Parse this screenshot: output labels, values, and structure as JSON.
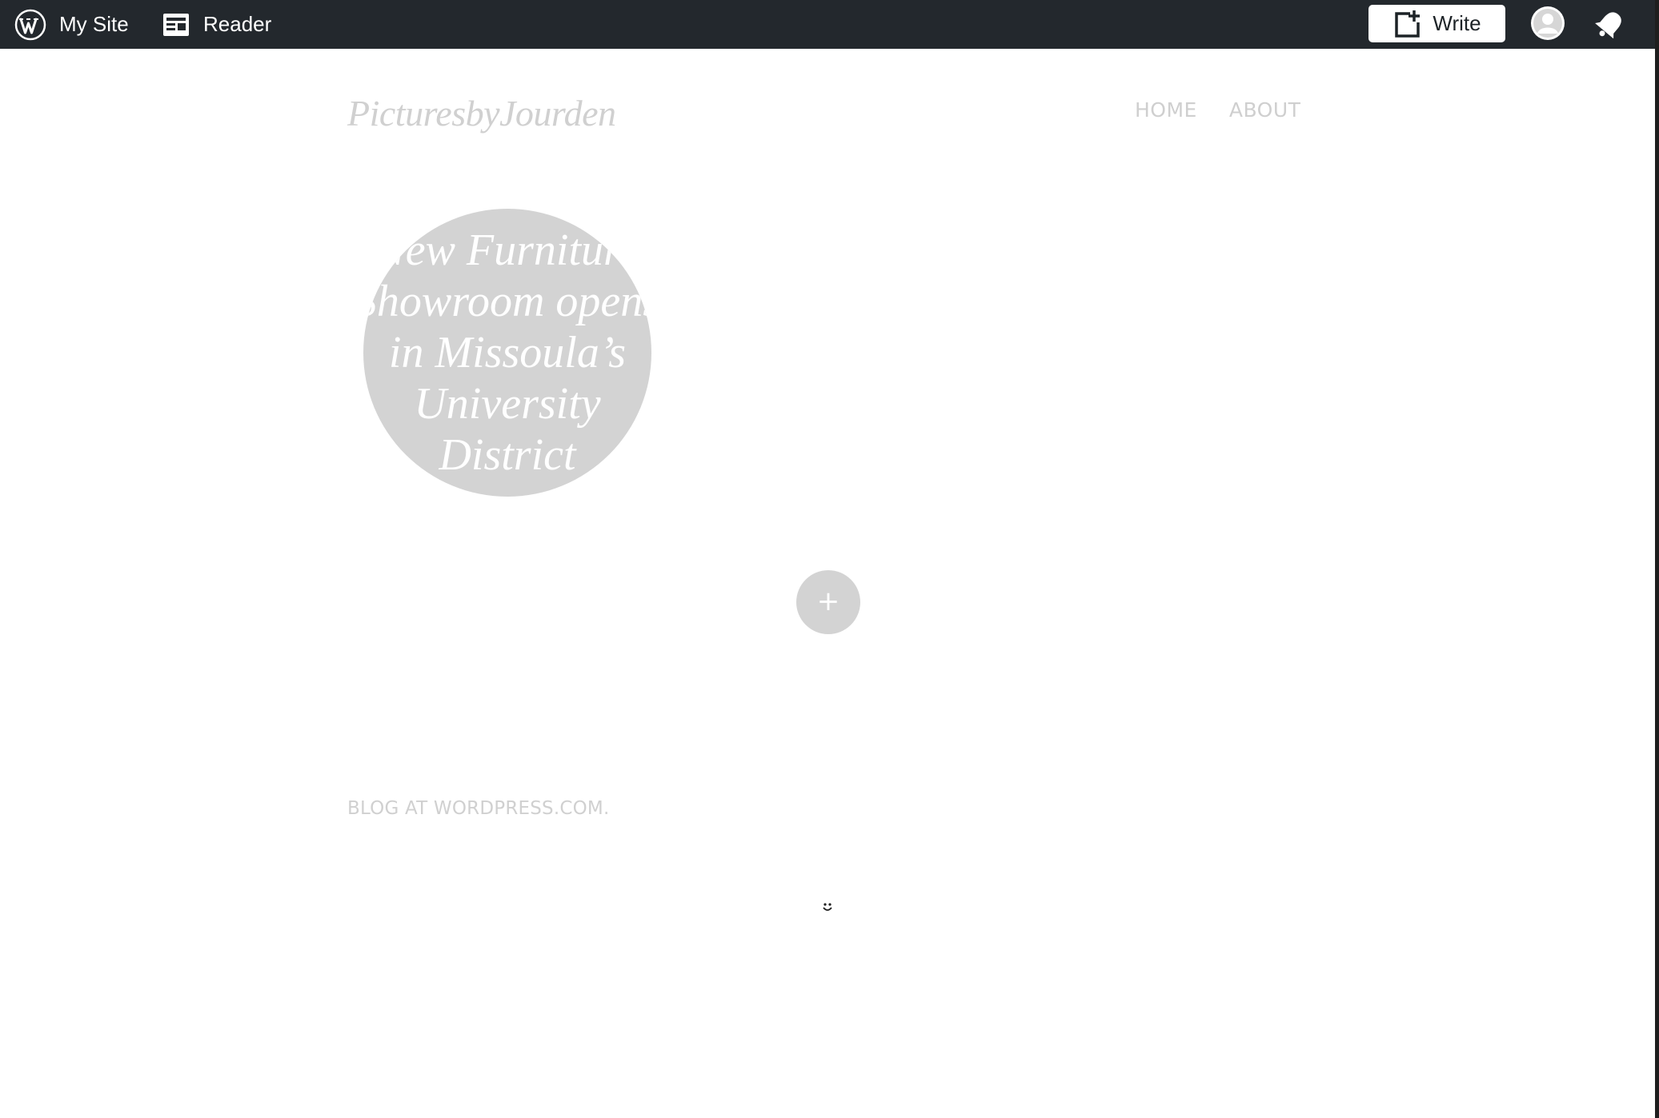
{
  "admin_bar": {
    "my_site_label": "My Site",
    "reader_label": "Reader",
    "write_label": "Write",
    "icons": {
      "logo": "wordpress-logo-icon",
      "reader": "reader-icon",
      "write": "new-post-icon",
      "avatar": "user-avatar-icon",
      "notifications": "notifications-bell-icon"
    },
    "background_color": "#23282d"
  },
  "site": {
    "title": "PicturesbyJourden",
    "nav": [
      {
        "label": "HOME"
      },
      {
        "label": "ABOUT"
      }
    ]
  },
  "posts": [
    {
      "title_lines": [
        "New Furniture",
        "Showroom opens",
        "in Missoula’s",
        "University",
        "District"
      ]
    }
  ],
  "load_more": {
    "glyph": "+",
    "icon": "plus-icon"
  },
  "footer": {
    "credit": "BLOG AT WORDPRESS.COM."
  },
  "colors": {
    "accent_gray": "#d3d3d3",
    "text_light": "#cfcfcf"
  }
}
